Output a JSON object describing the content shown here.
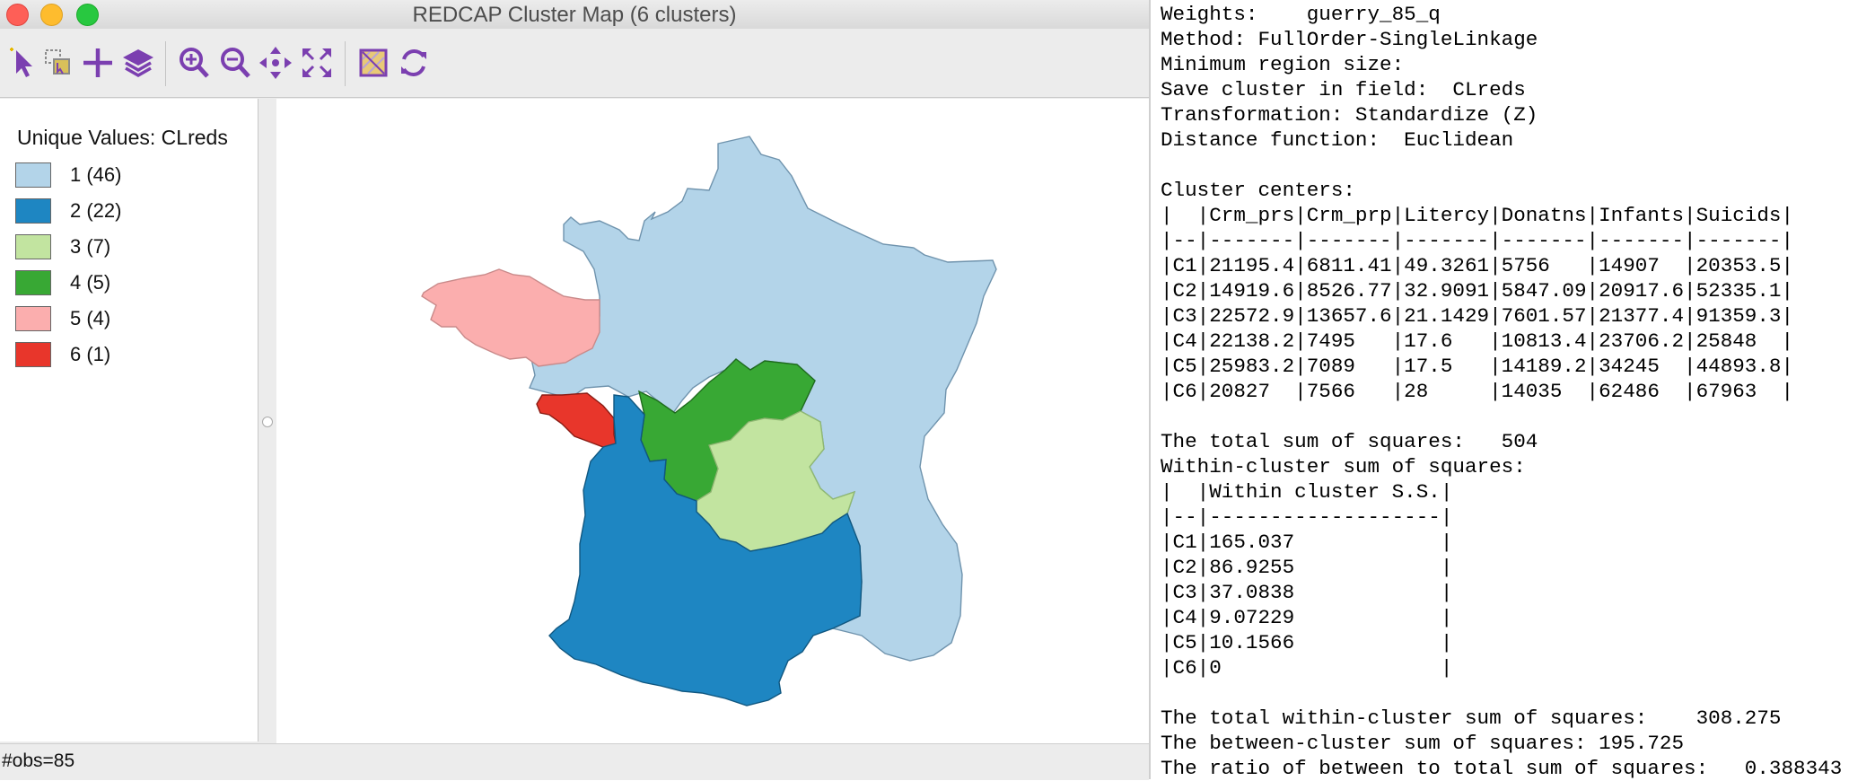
{
  "window": {
    "title": "REDCAP Cluster Map (6 clusters)"
  },
  "toolbar": {
    "tools": [
      {
        "name": "select-tool-icon"
      },
      {
        "name": "selection-mode-icon"
      },
      {
        "name": "add-icon"
      },
      {
        "name": "layers-icon"
      },
      {
        "name": "zoom-in-icon"
      },
      {
        "name": "zoom-out-icon"
      },
      {
        "name": "pan-icon"
      },
      {
        "name": "fit-extent-icon"
      },
      {
        "name": "basemap-icon"
      },
      {
        "name": "refresh-icon"
      }
    ]
  },
  "legend": {
    "title": "Unique Values: CLreds",
    "items": [
      {
        "label": "1 (46)",
        "color": "#b3d4e9"
      },
      {
        "label": "2 (22)",
        "color": "#1e86c2"
      },
      {
        "label": "3 (7)",
        "color": "#c2e4a0"
      },
      {
        "label": "4 (5)",
        "color": "#38a834"
      },
      {
        "label": "5 (4)",
        "color": "#fbaeae"
      },
      {
        "label": "6 (1)",
        "color": "#e8362b"
      }
    ]
  },
  "status": {
    "obs": "#obs=85"
  },
  "output": {
    "lines": [
      "Weights:    guerry_85_q",
      "Method: FullOrder-SingleLinkage",
      "Minimum region size:",
      "Save cluster in field:  CLreds",
      "Transformation: Standardize (Z)",
      "Distance function:  Euclidean",
      "",
      "Cluster centers:",
      "|  |Crm_prs|Crm_prp|Litercy|Donatns|Infants|Suicids|",
      "|--|-------|-------|-------|-------|-------|-------|",
      "|C1|21195.4|6811.41|49.3261|5756   |14907  |20353.5|",
      "|C2|14919.6|8526.77|32.9091|5847.09|20917.6|52335.1|",
      "|C3|22572.9|13657.6|21.1429|7601.57|21377.4|91359.3|",
      "|C4|22138.2|7495   |17.6   |10813.4|23706.2|25848  |",
      "|C5|25983.2|7089   |17.5   |14189.2|34245  |44893.8|",
      "|C6|20827  |7566   |28     |14035  |62486  |67963  |",
      "",
      "The total sum of squares:   504",
      "Within-cluster sum of squares:",
      "|  |Within cluster S.S.|",
      "|--|-------------------|",
      "|C1|165.037            |",
      "|C2|86.9255            |",
      "|C3|37.0838            |",
      "|C4|9.07229            |",
      "|C5|10.1566            |",
      "|C6|0                  |",
      "",
      "The total within-cluster sum of squares:    308.275",
      "The between-cluster sum of squares: 195.725",
      "The ratio of between to total sum of squares:   0.388343"
    ]
  }
}
